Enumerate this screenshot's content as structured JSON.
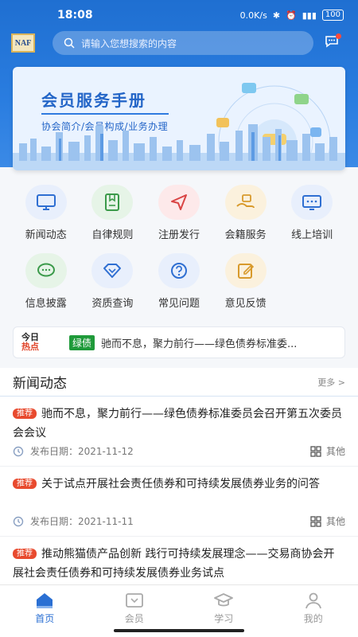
{
  "status": {
    "time": "18:08",
    "net": "0.0K/s",
    "battery": "100"
  },
  "header": {
    "logo_text": "NAFMII",
    "search_placeholder": "请输入您想搜索的内容"
  },
  "banner": {
    "title": "会员服务手册",
    "subtitle": "协会简介/会员构成/业务办理"
  },
  "grid": [
    {
      "label": "新闻动态",
      "icon": "monitor-icon",
      "color": "#e8effc"
    },
    {
      "label": "自律规则",
      "icon": "book-icon",
      "color": "#e6f4e7"
    },
    {
      "label": "注册发行",
      "icon": "send-icon",
      "color": "#fde9ea"
    },
    {
      "label": "会籍服务",
      "icon": "hand-service-icon",
      "color": "#fbf1dd"
    },
    {
      "label": "线上培训",
      "icon": "screen-chat-icon",
      "color": "#e8effc"
    },
    {
      "label": "信息披露",
      "icon": "chat-bubble-icon",
      "color": "#e6f4e7"
    },
    {
      "label": "资质查询",
      "icon": "diamond-icon",
      "color": "#e8effc"
    },
    {
      "label": "常见问题",
      "icon": "question-icon",
      "color": "#e8effc"
    },
    {
      "label": "意见反馈",
      "icon": "edit-icon",
      "color": "#fbf1dd"
    }
  ],
  "ticker": {
    "logo_top": "今日",
    "logo_bottom": "热点",
    "tag": "绿债",
    "text": "驰而不息，聚力前行——绿色债券标准委..."
  },
  "news": {
    "title": "新闻动态",
    "more": "更多 >",
    "badge": "推荐",
    "date_label": "发布日期：",
    "category": "其他",
    "items": [
      {
        "title": "驰而不息，聚力前行——绿色债券标准委员会召开第五次委员会会议",
        "date": "2021-11-12"
      },
      {
        "title": "关于试点开展社会责任债券和可持续发展债券业务的问答",
        "date": "2021-11-11"
      },
      {
        "title": "推动熊猫债产品创新 践行可持续发展理念——交易商协会开展社会责任债券和可持续发展债券业务试点",
        "date": ""
      }
    ]
  },
  "nav": [
    {
      "label": "首页",
      "icon": "home-icon",
      "active": true
    },
    {
      "label": "会员",
      "icon": "member-card-icon",
      "active": false
    },
    {
      "label": "学习",
      "icon": "graduation-cap-icon",
      "active": false
    },
    {
      "label": "我的",
      "icon": "user-icon",
      "active": false
    }
  ]
}
